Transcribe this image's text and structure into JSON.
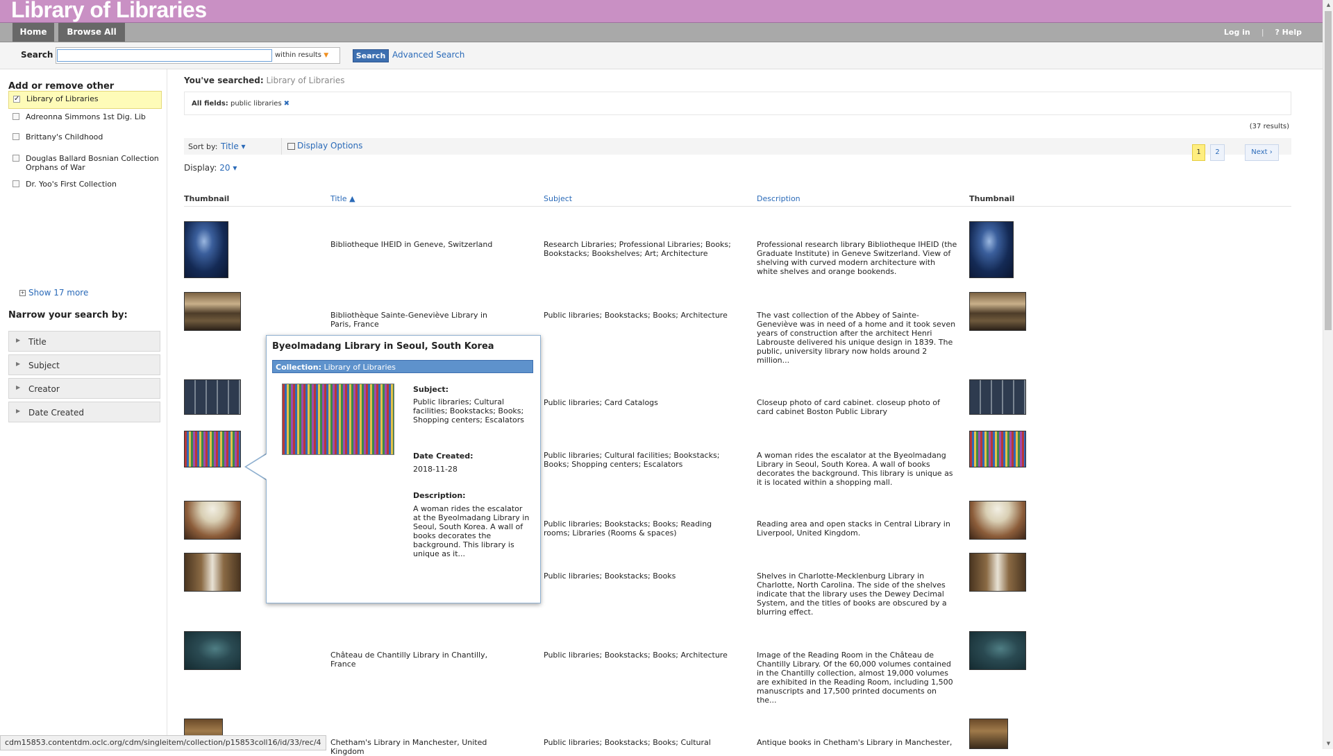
{
  "site": {
    "title": "Library of Libraries"
  },
  "nav": {
    "home": "Home",
    "browse_all": "Browse All",
    "login": "Log in",
    "help": "? Help",
    "separator": "|"
  },
  "search": {
    "label": "Search",
    "value": "",
    "scope": "within results",
    "button": "Search",
    "advanced": "Advanced Search"
  },
  "sidebar": {
    "heading": "Add or remove other collections to your search:",
    "collections": [
      {
        "label": "Library of Libraries",
        "checked": true
      },
      {
        "label": "Adreonna Simmons 1st Dig. Lib",
        "checked": false
      },
      {
        "label": "Brittany's Childhood",
        "checked": false
      },
      {
        "label": "Douglas Ballard Bosnian Collection Orphans of War",
        "checked": false
      },
      {
        "label": "Dr. Yoo's First Collection",
        "checked": false
      }
    ],
    "show_more": "Show 17 more",
    "narrow_heading": "Narrow your search by:",
    "facets": [
      "Title",
      "Subject",
      "Creator",
      "Date Created"
    ]
  },
  "results": {
    "you_searched_label": "You've searched:",
    "you_searched_value": "Library of Libraries",
    "filter_label": "All fields:",
    "filter_value": "public libraries",
    "filter_remove": "✖",
    "count": "(37 results)",
    "sort_label": "Sort by:",
    "sort_value": "Title ▾",
    "display_options": "Display Options",
    "display_label": "Display:",
    "display_value": "20 ▾",
    "pages": [
      "1",
      "2"
    ],
    "next": "Next ›",
    "columns": {
      "thumb1": "Thumbnail",
      "title": "Title ▲",
      "subject": "Subject",
      "description": "Description",
      "thumb2": "Thumbnail"
    },
    "rows": [
      {
        "title": "Bibliotheque IHEID in Geneve, Switzerland",
        "subject": "Research Libraries; Professional Libraries; Books; Bookstacks; Bookshelves; Art; Architecture",
        "description": "Professional research library Bibliotheque IHEID (the Graduate Institute) in Geneve Switzerland. View of shelving with curved modern architecture with white shelves and orange bookends."
      },
      {
        "title": "Bibliothèque Sainte-Geneviève Library in Paris, France",
        "subject": "Public libraries; Bookstacks; Books; Architecture",
        "description": "The vast collection of the Abbey of Sainte-Geneviève was in need of a home and it took seven years of construction after the architect Henri Labrouste delivered his unique design in 1839. The public, university library now holds around 2 million..."
      },
      {
        "title": "",
        "subject": "Public libraries; Card Catalogs",
        "description": "Closeup photo of card cabinet. closeup photo of card cabinet Boston Public Library"
      },
      {
        "title": "",
        "subject": "Public libraries; Cultural facilities; Bookstacks; Books; Shopping centers; Escalators",
        "description": "A woman rides the escalator at the Byeolmadang Library in Seoul, South Korea. A wall of books decorates the background. This library is unique as it is located within a shopping mall."
      },
      {
        "title": "",
        "subject": "Public libraries; Bookstacks; Books; Reading rooms; Libraries (Rooms & spaces)",
        "description": "Reading area and open stacks in Central Library in Liverpool, United Kingdom."
      },
      {
        "title": "",
        "subject": "Public libraries; Bookstacks; Books",
        "description": "Shelves in Charlotte-Mecklenburg Library in Charlotte, North Carolina. The side of the shelves indicate that the library uses the Dewey Decimal System, and the titles of books are obscured by a blurring effect."
      },
      {
        "title": "Château de Chantilly Library in Chantilly, France",
        "subject": "Public libraries; Bookstacks; Books; Architecture",
        "description": "Image of the Reading Room in the Château de Chantilly Library. Of the 60,000 volumes contained in the Chantilly collection, almost 19,000 volumes are exhibited in the Reading Room, including 1,500 manuscripts and 17,500 printed documents on the..."
      },
      {
        "title": "Chetham's Library in Manchester, United Kingdom",
        "subject": "Public libraries; Bookstacks; Books; Cultural",
        "description": "Antique books in Chetham's Library in Manchester,"
      }
    ]
  },
  "popup": {
    "title": "Byeolmadang Library in Seoul, South Korea",
    "collection_label": "Collection:",
    "collection_value": "Library of Libraries",
    "subject_label": "Subject:",
    "subject_value": "Public libraries; Cultural facilities; Bookstacks; Books; Shopping centers; Escalators",
    "date_label": "Date Created:",
    "date_value": "2018-11-28",
    "desc_label": "Description:",
    "desc_value": "A woman rides the escalator at the Byeolmadang Library in Seoul, South Korea. A wall of books decorates the background. This library is unique as it..."
  },
  "status_url": "cdm15853.contentdm.oclc.org/cdm/singleitem/collection/p15853coll16/id/33/rec/4",
  "colors": {
    "header": "#c990c4",
    "nav": "#a9a9a9",
    "link": "#2a6ab8",
    "highlight": "#fefbb8",
    "popup_bar": "#5e92cc"
  }
}
